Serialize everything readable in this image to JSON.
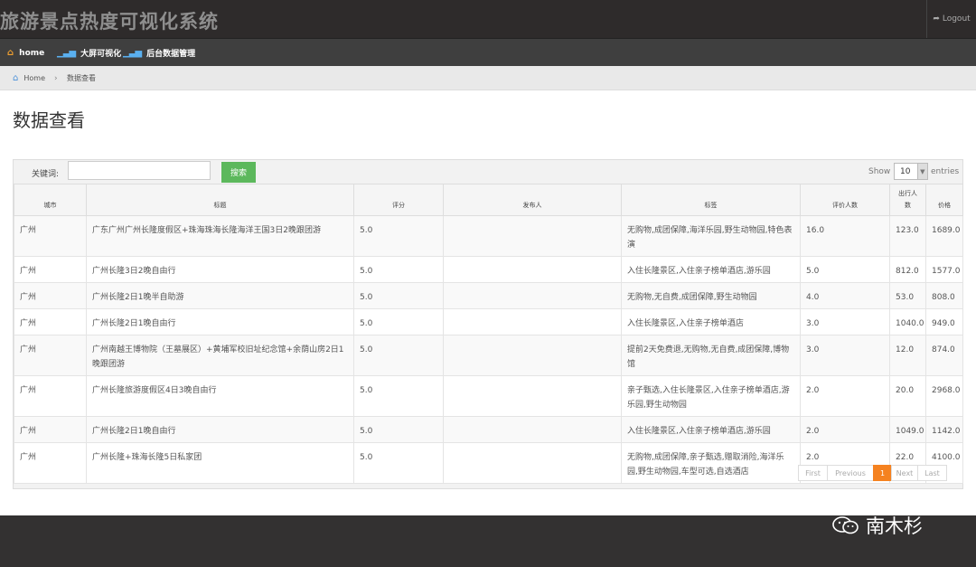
{
  "header": {
    "brand": "旅游景点热度可视化系统",
    "logout_label": "Logout"
  },
  "nav": {
    "items": [
      {
        "label": "home"
      },
      {
        "label": "大屏可视化"
      },
      {
        "label": "后台数据管理"
      }
    ]
  },
  "breadcrumb": {
    "home": "Home",
    "current": "数据查看"
  },
  "page": {
    "title": "数据查看"
  },
  "search": {
    "label": "关键词:",
    "value": "",
    "button": "搜索"
  },
  "length": {
    "show": "Show",
    "value": "10",
    "entries": "entries"
  },
  "table": {
    "headers": [
      "城市",
      "标题",
      "评分",
      "发布人",
      "标签",
      "评价人数",
      "出行人数",
      "价格"
    ],
    "rows": [
      [
        "广州",
        "广东广州广州长隆度假区+珠海珠海长隆海洋王国3日2晚跟团游",
        "5.0",
        "",
        "无购物,成团保障,海洋乐园,野生动物园,特色表演",
        "16.0",
        "123.0",
        "1689.0"
      ],
      [
        "广州",
        "广州长隆3日2晚自由行",
        "5.0",
        "",
        "入住长隆景区,入住亲子榜单酒店,游乐园",
        "5.0",
        "812.0",
        "1577.0"
      ],
      [
        "广州",
        "广州长隆2日1晚半自助游",
        "5.0",
        "",
        "无购物,无自费,成团保障,野生动物园",
        "4.0",
        "53.0",
        "808.0"
      ],
      [
        "广州",
        "广州长隆2日1晚自由行",
        "5.0",
        "",
        "入住长隆景区,入住亲子榜单酒店",
        "3.0",
        "1040.0",
        "949.0"
      ],
      [
        "广州",
        "广州南越王博物院（王墓展区）+黄埔军校旧址纪念馆+余荫山房2日1晚跟团游",
        "5.0",
        "",
        "提前2天免费退,无购物,无自费,成团保障,博物馆",
        "3.0",
        "12.0",
        "874.0"
      ],
      [
        "广州",
        "广州长隆旅游度假区4日3晚自由行",
        "5.0",
        "",
        "亲子甄选,入住长隆景区,入住亲子榜单酒店,游乐园,野生动物园",
        "2.0",
        "20.0",
        "2968.0"
      ],
      [
        "广州",
        "广州长隆2日1晚自由行",
        "5.0",
        "",
        "入住长隆景区,入住亲子榜单酒店,游乐园",
        "2.0",
        "1049.0",
        "1142.0"
      ],
      [
        "广州",
        "广州长隆+珠海长隆5日私家团",
        "5.0",
        "",
        "无购物,成团保障,亲子甄选,赠取消险,海洋乐园,野生动物园,车型可选,自选酒店",
        "2.0",
        "22.0",
        "4100.0"
      ]
    ]
  },
  "pagination": {
    "first": "First",
    "previous": "Previous",
    "current": "1",
    "next": "Next",
    "last": "Last"
  },
  "watermark": {
    "text": "南木杉"
  }
}
